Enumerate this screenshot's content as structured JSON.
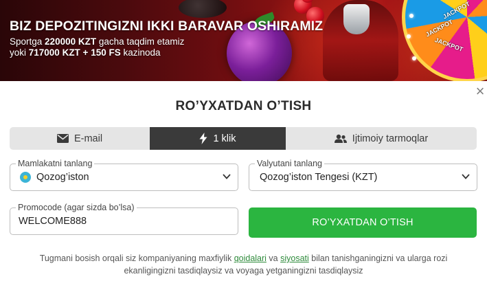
{
  "banner": {
    "title": "BIZ DEPOZITINGIZNI IKKI BARAVAR OSHIRAMIZ",
    "line1_prefix": "Sportga ",
    "line1_amount": "220000 KZT",
    "line1_suffix": " gacha taqdim etamiz",
    "line2_prefix": "yoki ",
    "line2_amount": "717000 KZT + 150 FS",
    "line2_suffix": " kazinoda",
    "wheel_labels": [
      "JACKPOT",
      "JACKPOT",
      "JACKPOT"
    ]
  },
  "modal": {
    "close_glyph": "×",
    "title": "RO’YXATDAN O’TISH"
  },
  "tabs": [
    {
      "label": "E-mail",
      "icon": "envelope-icon",
      "active": false
    },
    {
      "label": "1 klik",
      "icon": "lightning-icon",
      "active": true
    },
    {
      "label": "Ijtimoiy tarmoqlar",
      "icon": "users-icon",
      "active": false
    }
  ],
  "form": {
    "country": {
      "legend": "Mamlakatni tanlang",
      "value": "Qozog’iston",
      "flag": "kazakhstan-flag"
    },
    "currency": {
      "legend": "Valyutani tanlang",
      "value": "Qozog’iston Tengesi (KZT)"
    },
    "promo": {
      "legend": "Promocode (agar sizda bo’lsa)",
      "value": "WELCOME888"
    },
    "submit_label": "RO’YXATDAN O’TISH"
  },
  "terms": {
    "part1": "Tugmani bosish orqali siz kompaniyaning maxfiylik ",
    "link1": "qoidalari",
    "part2": " va ",
    "link2": "siyosati",
    "part3": " bilan tanishganingizni va ularga rozi ekanligingizni tasdiqlaysiz va voyaga yetganingizni tasdiqlaysiz"
  },
  "colors": {
    "accent_green": "#2bb540",
    "active_tab": "#3a3a3a",
    "link": "#2d8a3a"
  }
}
